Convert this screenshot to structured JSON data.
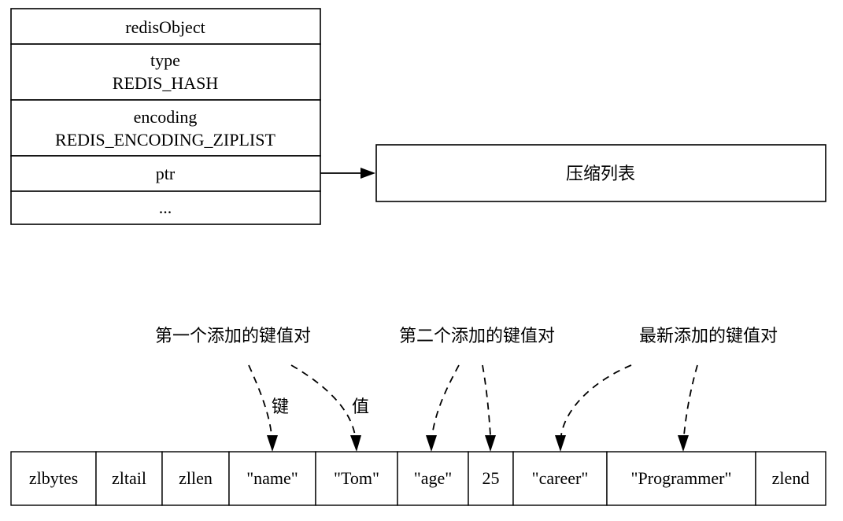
{
  "redis_object": {
    "rows": [
      {
        "lines": [
          "redisObject"
        ]
      },
      {
        "lines": [
          "type",
          "REDIS_HASH"
        ]
      },
      {
        "lines": [
          "encoding",
          "REDIS_ENCODING_ZIPLIST"
        ]
      },
      {
        "lines": [
          "ptr"
        ]
      },
      {
        "lines": [
          "..."
        ]
      }
    ]
  },
  "target_box": {
    "label": "压缩列表"
  },
  "annotations": {
    "first_pair": "第一个添加的键值对",
    "second_pair": "第二个添加的键值对",
    "newest_pair": "最新添加的键值对",
    "key_label": "键",
    "value_label": "值"
  },
  "ziplist": {
    "cells": [
      "zlbytes",
      "zltail",
      "zllen",
      "\"name\"",
      "\"Tom\"",
      "\"age\"",
      "25",
      "\"career\"",
      "\"Programmer\"",
      "zlend"
    ]
  }
}
